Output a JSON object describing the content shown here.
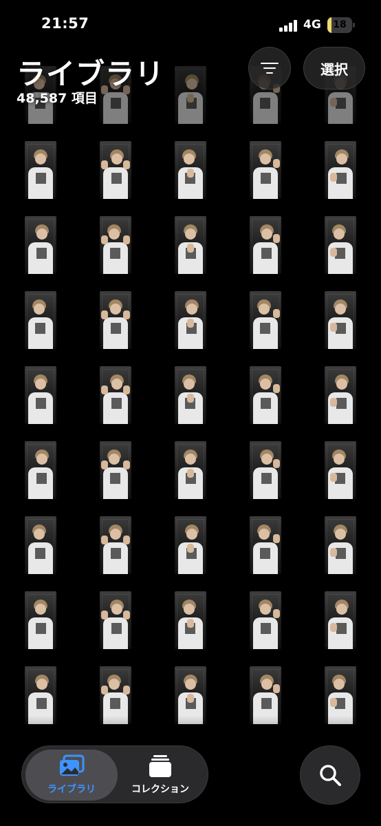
{
  "status_bar": {
    "time": "21:57",
    "network": "4G",
    "battery_level": "18",
    "battery_color": "#f1d96a"
  },
  "header": {
    "title": "ライブラリ",
    "item_count": "48,587 項目",
    "sort_icon": "line-3-horizontal-decrease-icon",
    "select_label": "選択"
  },
  "grid": {
    "columns": 5,
    "visible_rows": 9
  },
  "tab_bar": {
    "accent_color": "#3d93ff",
    "tabs": [
      {
        "label": "ライブラリ",
        "icon": "photo-stack-icon",
        "selected": true
      },
      {
        "label": "コレクション",
        "icon": "collection-stack-icon",
        "selected": false
      }
    ]
  },
  "search": {
    "icon": "magnifying-glass-icon"
  }
}
